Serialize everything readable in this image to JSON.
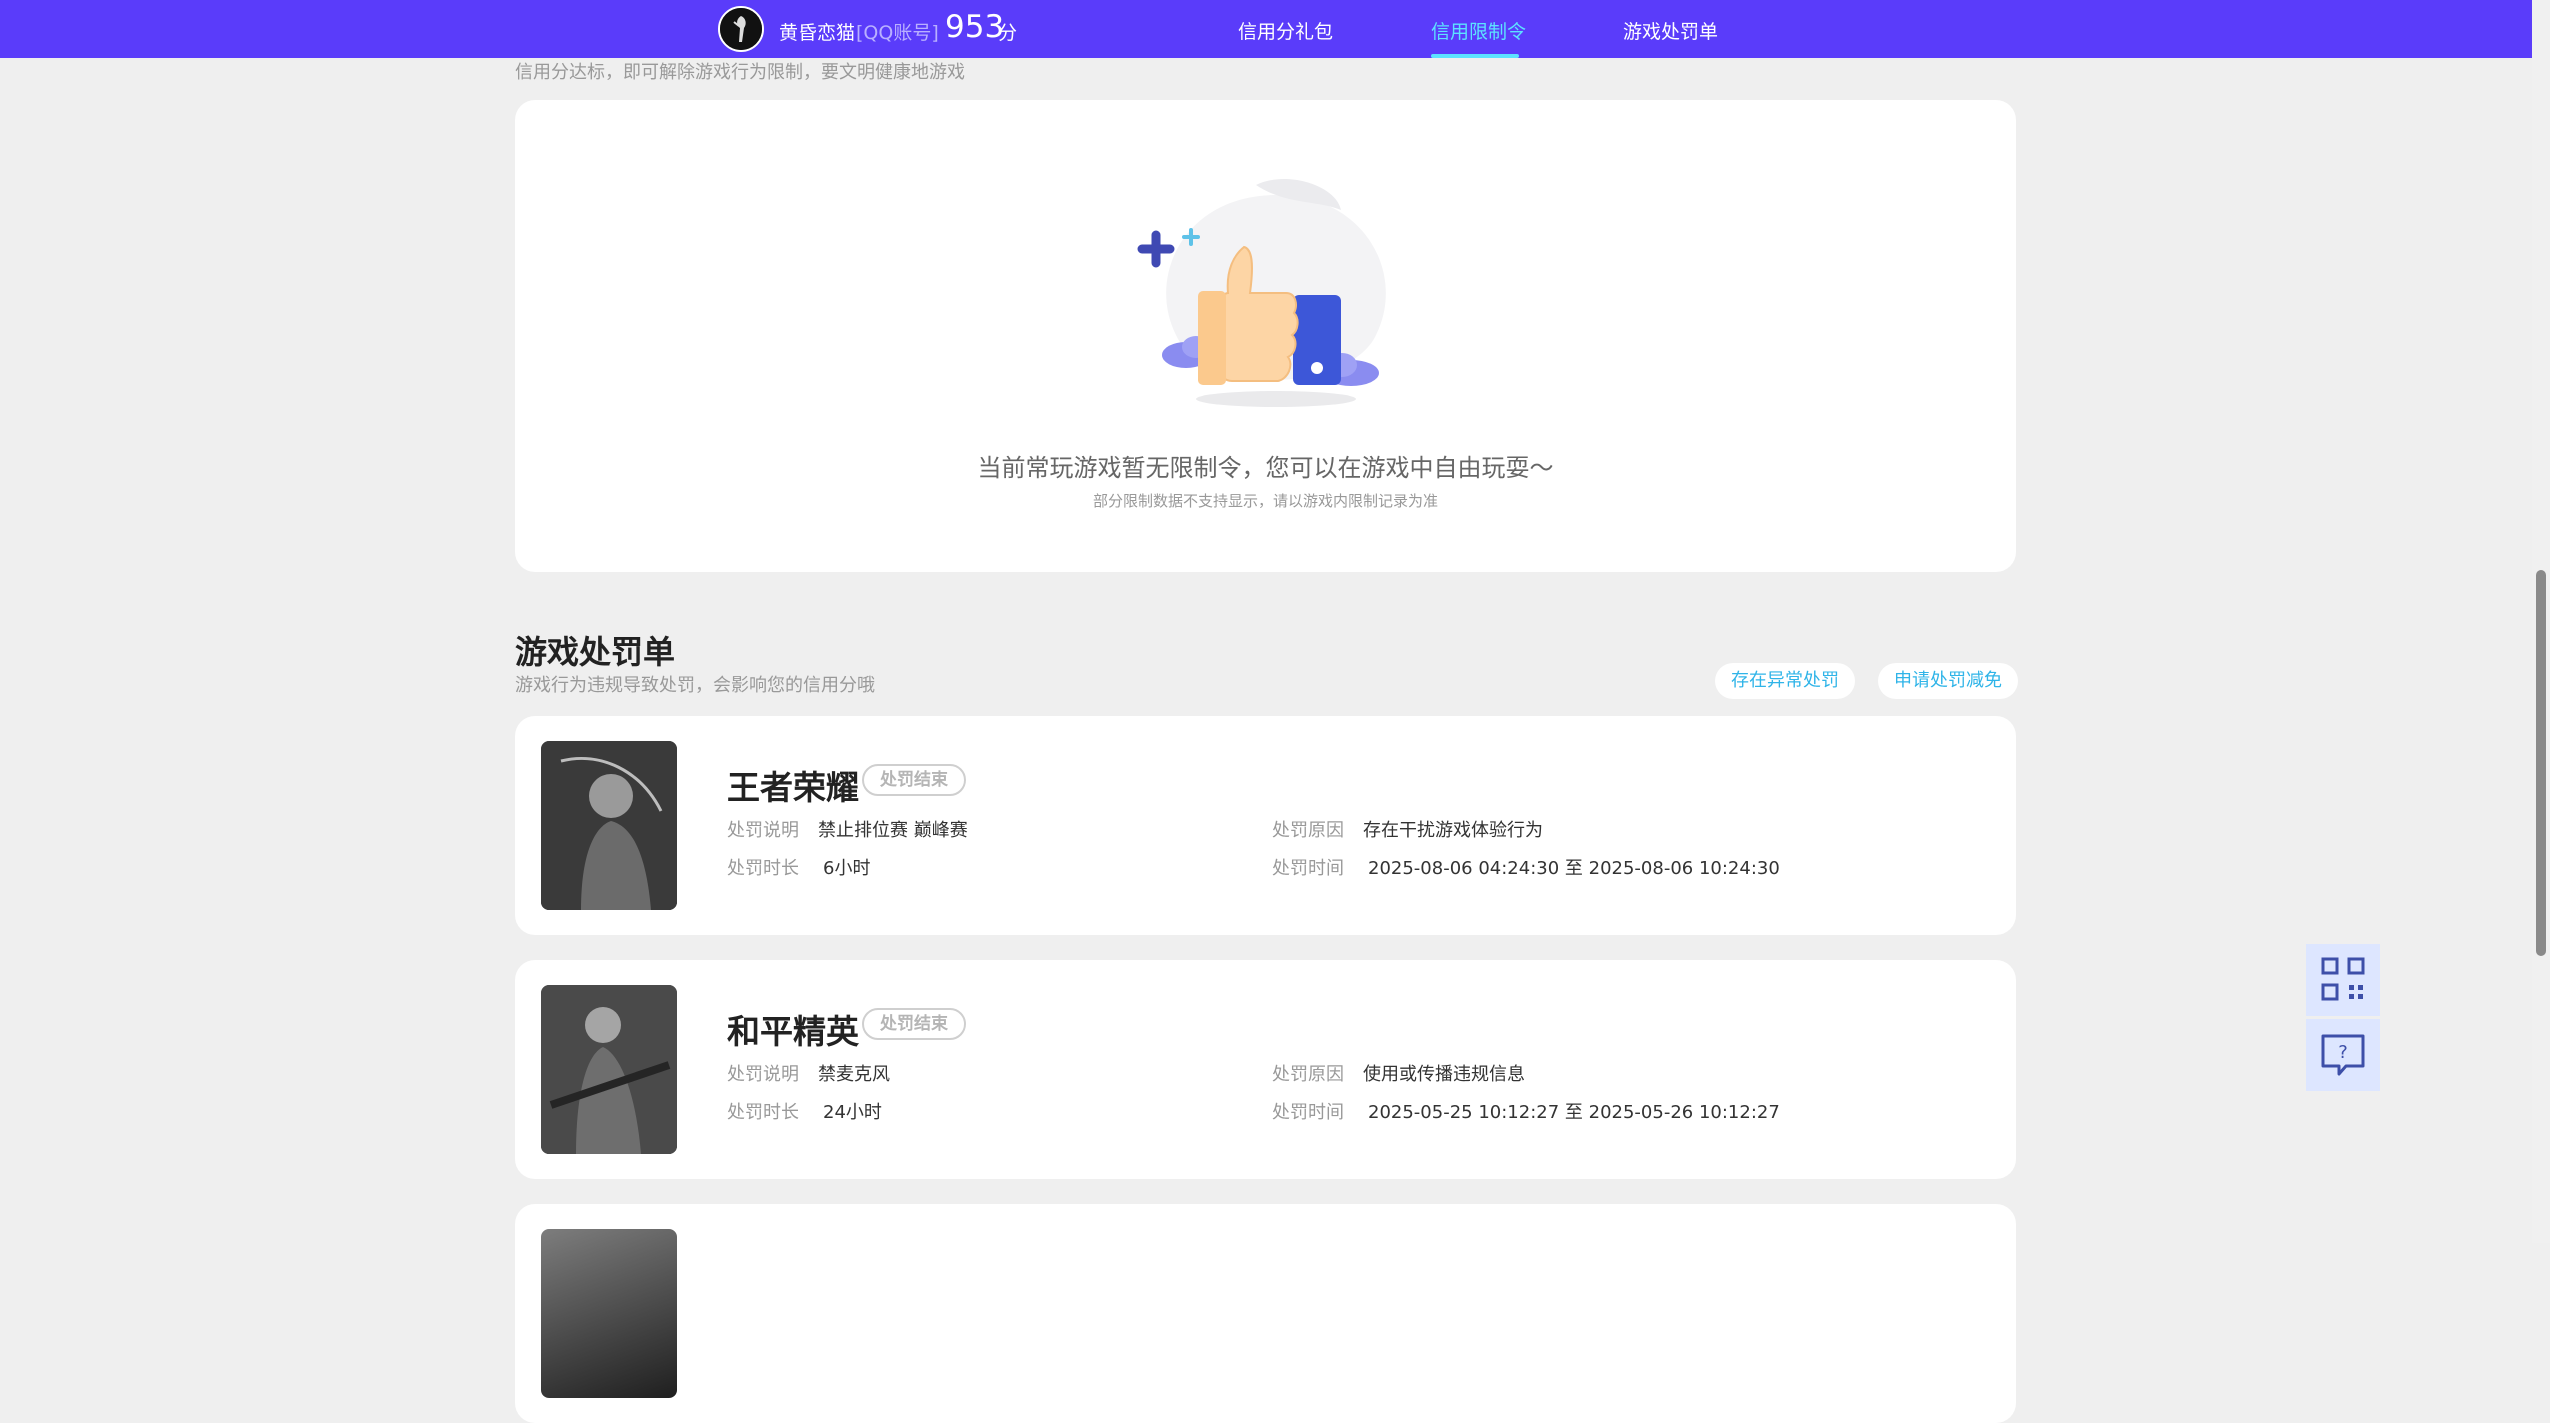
{
  "header": {
    "nickname": "黄昏恋猫",
    "account_label": "[QQ账号]",
    "score": "953",
    "score_unit": "分",
    "nav": [
      {
        "label": "信用分礼包"
      },
      {
        "label": "信用限制令"
      },
      {
        "label": "游戏处罚单"
      }
    ],
    "active_nav": "信用限制令",
    "accent_color": "#5a3cfa",
    "active_color": "#5de2ff"
  },
  "restriction": {
    "subtitle": "信用分达标，即可解除游戏行为限制，要文明健康地游戏",
    "empty_title": "当前常玩游戏暂无限制令，您可以在游戏中自由玩耍～",
    "empty_sub": "部分限制数据不支持显示，请以游戏内限制记录为准"
  },
  "penalty": {
    "title": "游戏处罚单",
    "subtitle": "游戏行为违规导致处罚，会影响您的信用分哦",
    "btn_abnormal": "存在异常处罚",
    "btn_apply": "申请处罚减免",
    "label_desc": "处罚说明",
    "label_reason": "处罚原因",
    "label_duration": "处罚时长",
    "label_time": "处罚时间",
    "items": [
      {
        "game": "王者荣耀",
        "status": "处罚结束",
        "desc": "禁止排位赛 巅峰赛",
        "reason": "存在干扰游戏体验行为",
        "duration": "6小时",
        "time": "2025-08-06 04:24:30 至 2025-08-06 10:24:30"
      },
      {
        "game": "和平精英",
        "status": "处罚结束",
        "desc": "禁麦克风",
        "reason": "使用或传播违规信息",
        "duration": "24小时",
        "time": "2025-05-25 10:12:27 至 2025-05-26 10:12:27"
      }
    ]
  },
  "tools": [
    {
      "icon": "qr-code-icon"
    },
    {
      "icon": "feedback-icon"
    }
  ]
}
